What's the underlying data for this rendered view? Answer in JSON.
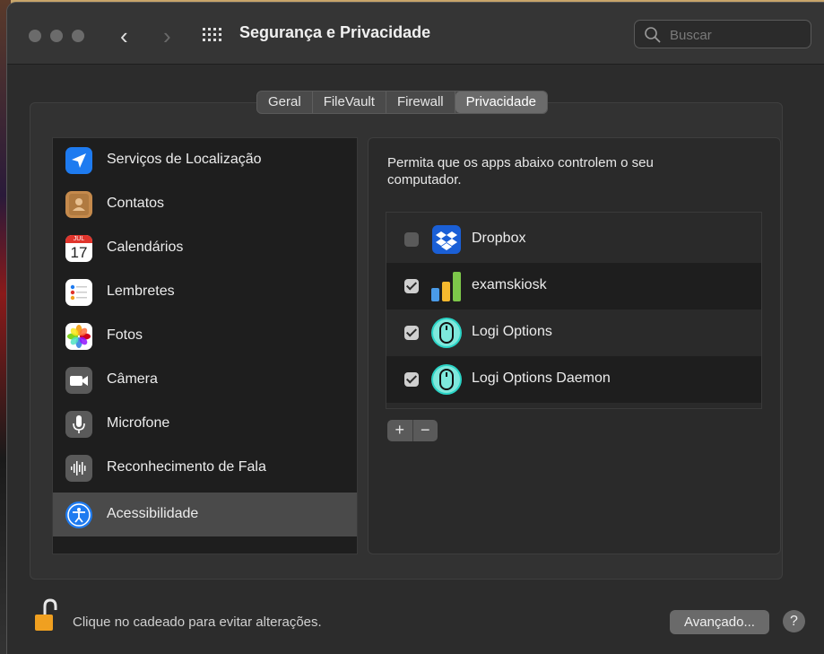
{
  "window": {
    "title": "Segurança e Privacidade",
    "search_placeholder": "Buscar",
    "nav_back": "‹",
    "nav_forward": "›"
  },
  "tabs": [
    {
      "label": "Geral",
      "active": false
    },
    {
      "label": "FileVault",
      "active": false
    },
    {
      "label": "Firewall",
      "active": false
    },
    {
      "label": "Privacidade",
      "active": true
    }
  ],
  "sidebar": {
    "items": [
      {
        "label": "Serviços de Localização",
        "icon": "location-arrow-icon",
        "color": "#1e7bf0"
      },
      {
        "label": "Contatos",
        "icon": "contacts-icon",
        "color": "#c58a4c"
      },
      {
        "label": "Calendários",
        "icon": "calendar-icon",
        "color": "#ffffff",
        "month": "JUL",
        "day": "17"
      },
      {
        "label": "Lembretes",
        "icon": "reminders-icon",
        "color": "#ffffff"
      },
      {
        "label": "Fotos",
        "icon": "photos-icon",
        "color": "#ffffff"
      },
      {
        "label": "Câmera",
        "icon": "camera-icon",
        "color": "#5a5a5a"
      },
      {
        "label": "Microfone",
        "icon": "microphone-icon",
        "color": "#5a5a5a"
      },
      {
        "label": "Reconhecimento de Fala",
        "icon": "speech-recognition-icon",
        "color": "#5a5a5a"
      },
      {
        "label": "Acessibilidade",
        "icon": "accessibility-icon",
        "color": "#1e7bf0",
        "selected": true
      }
    ]
  },
  "detail": {
    "description": "Permita que os apps abaixo controlem o seu computador.",
    "apps": [
      {
        "label": "Dropbox",
        "checked": false,
        "icon": "dropbox-icon"
      },
      {
        "label": "examskiosk",
        "checked": true,
        "icon": "examskiosk-icon"
      },
      {
        "label": "Logi Options",
        "checked": true,
        "icon": "logi-mouse-icon"
      },
      {
        "label": "Logi Options Daemon",
        "checked": true,
        "icon": "logi-mouse-icon"
      }
    ],
    "add_label": "+",
    "remove_label": "−"
  },
  "footer": {
    "lock_message": "Clique no cadeado para evitar alterações.",
    "advanced_label": "Avançado...",
    "help_label": "?"
  }
}
